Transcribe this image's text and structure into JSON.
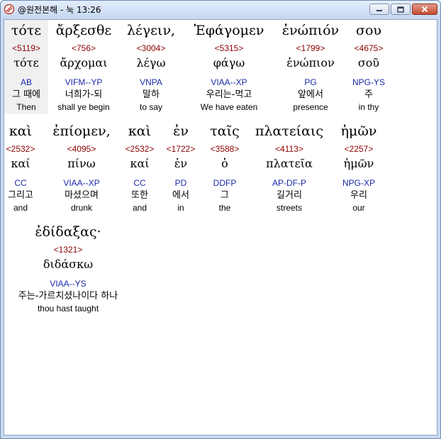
{
  "window": {
    "title": "@원전본해 - 눅 13:26",
    "minimize_icon": "minimize-icon",
    "maximize_icon": "maximize-icon",
    "close_icon": "close-icon"
  },
  "rows": [
    {
      "words": [
        {
          "greek": "τότε",
          "strong": "<5119>",
          "lemma": "τότε",
          "morph": "AB",
          "korean": "그 때에",
          "english": "Then"
        },
        {
          "greek": "ἄρξεσθε",
          "strong": "<756>",
          "lemma": "ἄρχομαι",
          "morph": "VIFM--YP",
          "korean": "너희가-되",
          "english": "shall ye begin"
        },
        {
          "greek": "λέγειν,",
          "strong": "<3004>",
          "lemma": "λέγω",
          "morph": "VNPA",
          "korean": "말하",
          "english": "to say"
        },
        {
          "greek": "Ἐφάγομεν",
          "strong": "<5315>",
          "lemma": "φάγω",
          "morph": "VIAA--XP",
          "korean": "우리는-먹고",
          "english": "We have eaten"
        },
        {
          "greek": "ἐνώπιόν",
          "strong": "<1799>",
          "lemma": "ἐνώπιον",
          "morph": "PG",
          "korean": "앞에서",
          "english": "presence"
        },
        {
          "greek": "σου",
          "strong": "<4675>",
          "lemma": "σοῦ",
          "morph": "NPG-YS",
          "korean": "주",
          "english": "in thy"
        }
      ]
    },
    {
      "words": [
        {
          "greek": "καὶ",
          "strong": "<2532>",
          "lemma": "καί",
          "morph": "CC",
          "korean": "그리고",
          "english": "and"
        },
        {
          "greek": "ἐπίομεν,",
          "strong": "<4095>",
          "lemma": "πίνω",
          "morph": "VIAA--XP",
          "korean": "마셨으며",
          "english": "drunk"
        },
        {
          "greek": "καὶ",
          "strong": "<2532>",
          "lemma": "καί",
          "morph": "CC",
          "korean": "또한",
          "english": "and"
        },
        {
          "greek": "ἐν",
          "strong": "<1722>",
          "lemma": "ἐν",
          "morph": "PD",
          "korean": "에서",
          "english": "in"
        },
        {
          "greek": "ταῖς",
          "strong": "<3588>",
          "lemma": "ὁ",
          "morph": "DDFP",
          "korean": "그",
          "english": "the"
        },
        {
          "greek": "πλατείαις",
          "strong": "<4113>",
          "lemma": "πλατεῖα",
          "morph": "AP-DF-P",
          "korean": "길거리",
          "english": "streets"
        },
        {
          "greek": "ἡμῶν",
          "strong": "<2257>",
          "lemma": "ἡμῶν",
          "morph": "NPG-XP",
          "korean": "우리",
          "english": "our"
        }
      ]
    },
    {
      "words": [
        {
          "greek": "ἐδίδαξας·",
          "strong": "<1321>",
          "lemma": "διδάσκω",
          "morph": "VIAA--YS",
          "korean": "주는-가르치셨나이다 하나",
          "english": "thou hast taught"
        }
      ]
    }
  ]
}
